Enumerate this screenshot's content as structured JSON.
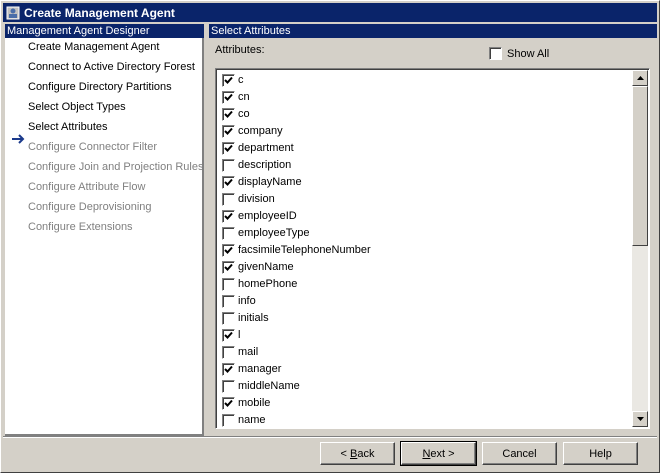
{
  "window": {
    "title": "Create Management Agent"
  },
  "left_panel": {
    "header": "Management Agent Designer",
    "items": [
      {
        "label": "Create Management Agent",
        "state": "enabled"
      },
      {
        "label": "Connect to Active Directory Forest",
        "state": "enabled"
      },
      {
        "label": "Configure Directory Partitions",
        "state": "enabled"
      },
      {
        "label": "Select Object Types",
        "state": "enabled"
      },
      {
        "label": "Select Attributes",
        "state": "current"
      },
      {
        "label": "Configure Connector Filter",
        "state": "disabled"
      },
      {
        "label": "Configure Join and Projection Rules",
        "state": "disabled"
      },
      {
        "label": "Configure Attribute Flow",
        "state": "disabled"
      },
      {
        "label": "Configure Deprovisioning",
        "state": "disabled"
      },
      {
        "label": "Configure Extensions",
        "state": "disabled"
      }
    ]
  },
  "right_panel": {
    "header": "Select Attributes",
    "attributes_label": "Attributes:",
    "show_all": {
      "label": "Show All",
      "checked": false
    },
    "attributes": [
      {
        "name": "c",
        "checked": true
      },
      {
        "name": "cn",
        "checked": true
      },
      {
        "name": "co",
        "checked": true
      },
      {
        "name": "company",
        "checked": true
      },
      {
        "name": "department",
        "checked": true
      },
      {
        "name": "description",
        "checked": false
      },
      {
        "name": "displayName",
        "checked": true
      },
      {
        "name": "division",
        "checked": false
      },
      {
        "name": "employeeID",
        "checked": true
      },
      {
        "name": "employeeType",
        "checked": false
      },
      {
        "name": "facsimileTelephoneNumber",
        "checked": true
      },
      {
        "name": "givenName",
        "checked": true
      },
      {
        "name": "homePhone",
        "checked": false
      },
      {
        "name": "info",
        "checked": false
      },
      {
        "name": "initials",
        "checked": false
      },
      {
        "name": "l",
        "checked": true
      },
      {
        "name": "mail",
        "checked": false
      },
      {
        "name": "manager",
        "checked": true
      },
      {
        "name": "middleName",
        "checked": false
      },
      {
        "name": "mobile",
        "checked": true
      },
      {
        "name": "name",
        "checked": false
      }
    ]
  },
  "buttons": {
    "back": {
      "prefix": "< ",
      "mnemonic": "B",
      "rest": "ack"
    },
    "next": {
      "mnemonic": "N",
      "rest": "ext",
      "suffix": " >"
    },
    "cancel": "Cancel",
    "help": "Help"
  },
  "icons": {
    "app": "management-agent-icon",
    "current_step": "arrow-right-icon",
    "scroll_up": "scroll-up-arrow-icon",
    "scroll_down": "scroll-down-arrow-icon"
  },
  "colors": {
    "titlebar": "#0a246a",
    "face": "#d4d0c8",
    "disabled_text": "#808080",
    "current_arrow": "#1b3a8c"
  }
}
